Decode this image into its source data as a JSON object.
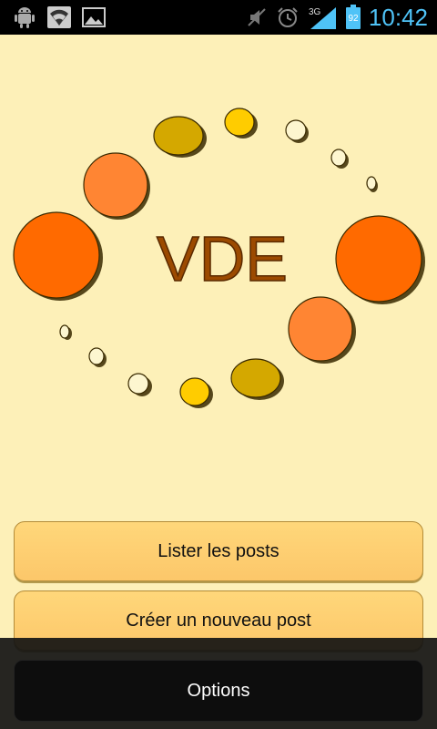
{
  "status_bar": {
    "left_icons": [
      "android-debug-icon",
      "wifi-icon",
      "image-icon"
    ],
    "right_icons": [
      "mute-icon",
      "alarm-icon",
      "signal-3g-icon",
      "battery-icon"
    ],
    "network_label": "3G",
    "battery_level": "92",
    "clock": "10:42"
  },
  "logo": {
    "text": "VDE",
    "colors": {
      "text_fill": "#9c4a00",
      "text_outline": "#5a2a00",
      "large": "#ff6a00",
      "medium": "#ff8533",
      "olive": "#d4a800",
      "yellow": "#ffcc00",
      "small": "#fdf6d0"
    }
  },
  "buttons": {
    "list_posts": "Lister les posts",
    "create_post": "Créer un nouveau post"
  },
  "menu": {
    "options": "Options"
  },
  "colors": {
    "background": "#fdf0b8",
    "button": "#fcc76a",
    "status_accent": "#4fc3f7"
  }
}
